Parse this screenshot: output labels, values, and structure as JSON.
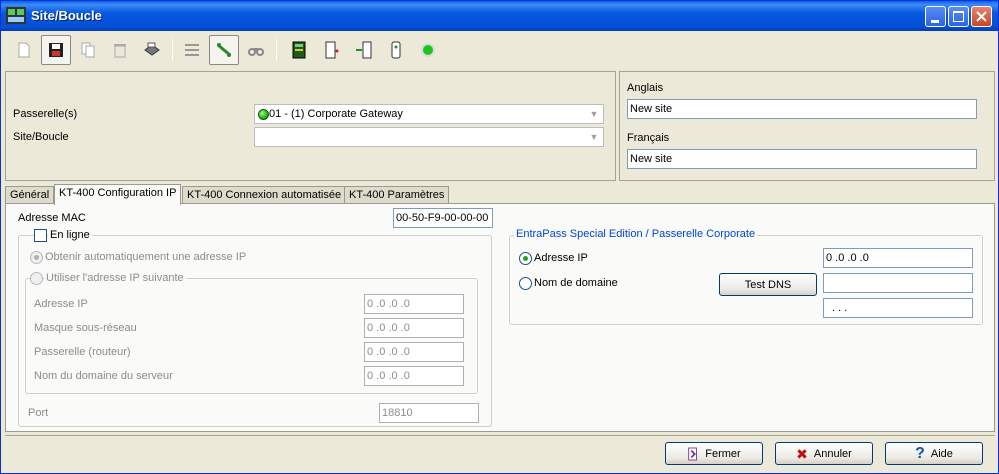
{
  "window": {
    "title": "Site/Boucle",
    "app_icon": "network-app-icon"
  },
  "toolbar": {
    "items": [
      {
        "icon": "new-doc-icon"
      },
      {
        "icon": "save-icon"
      },
      {
        "icon": "copy-icon"
      },
      {
        "icon": "delete-icon"
      },
      {
        "icon": "print-icon"
      },
      {
        "icon": "list-view-icon"
      },
      {
        "icon": "link-icon"
      },
      {
        "icon": "binoculars-icon"
      },
      {
        "icon": "controller-board-icon"
      },
      {
        "icon": "door-icon"
      },
      {
        "icon": "reader-icon"
      },
      {
        "icon": "device-icon"
      },
      {
        "icon": "status-green-icon"
      }
    ]
  },
  "top_panel": {
    "gateway_label": "Passerelle(s)",
    "gateway_value": "01 - (1)  Corporate Gateway",
    "site_label": "Site/Boucle",
    "site_value": ""
  },
  "names": {
    "english_label": "Anglais",
    "english_value": "New site",
    "french_label": "Français",
    "french_value": "New site"
  },
  "tabs": [
    {
      "label": "Général"
    },
    {
      "label": "KT-400 Configuration IP"
    },
    {
      "label": "KT-400 Connexion automatisée"
    },
    {
      "label": "KT-400 Paramètres"
    }
  ],
  "ip_config": {
    "mac_label": "Adresse MAC",
    "mac_value": "00-50-F9-00-00-00",
    "online_label": "En ligne",
    "auto_ip_label": "Obtenir automatiquement une adresse IP",
    "manual_ip_label": "Utiliser l'adresse IP suivante",
    "ip_label": "Adresse IP",
    "ip_value": "0 .0 .0 .0",
    "mask_label": "Masque sous-réseau",
    "mask_value": "0 .0 .0 .0",
    "gateway_label": "Passerelle (routeur)",
    "gateway_value": "0 .0 .0 .0",
    "dns_label": "Nom du domaine du serveur",
    "dns_value": "0 .0 .0 .0",
    "port_label": "Port",
    "port_value": "18810"
  },
  "entrapass": {
    "group_title": "EntraPass Special Edition / Passerelle Corporate",
    "ip_radio_label": "Adresse IP",
    "ip_value": "0 .0 .0 .0",
    "domain_radio_label": "Nom de domaine",
    "test_dns_label": "Test DNS",
    "domain_value": "",
    "resolved_value": ".  .  ."
  },
  "footer": {
    "close_label": "Fermer",
    "cancel_label": "Annuler",
    "help_label": "Aide"
  },
  "colors": {
    "titlebar": "#0658e0",
    "accent_blue": "#0046d5",
    "status_green": "#21a121"
  }
}
